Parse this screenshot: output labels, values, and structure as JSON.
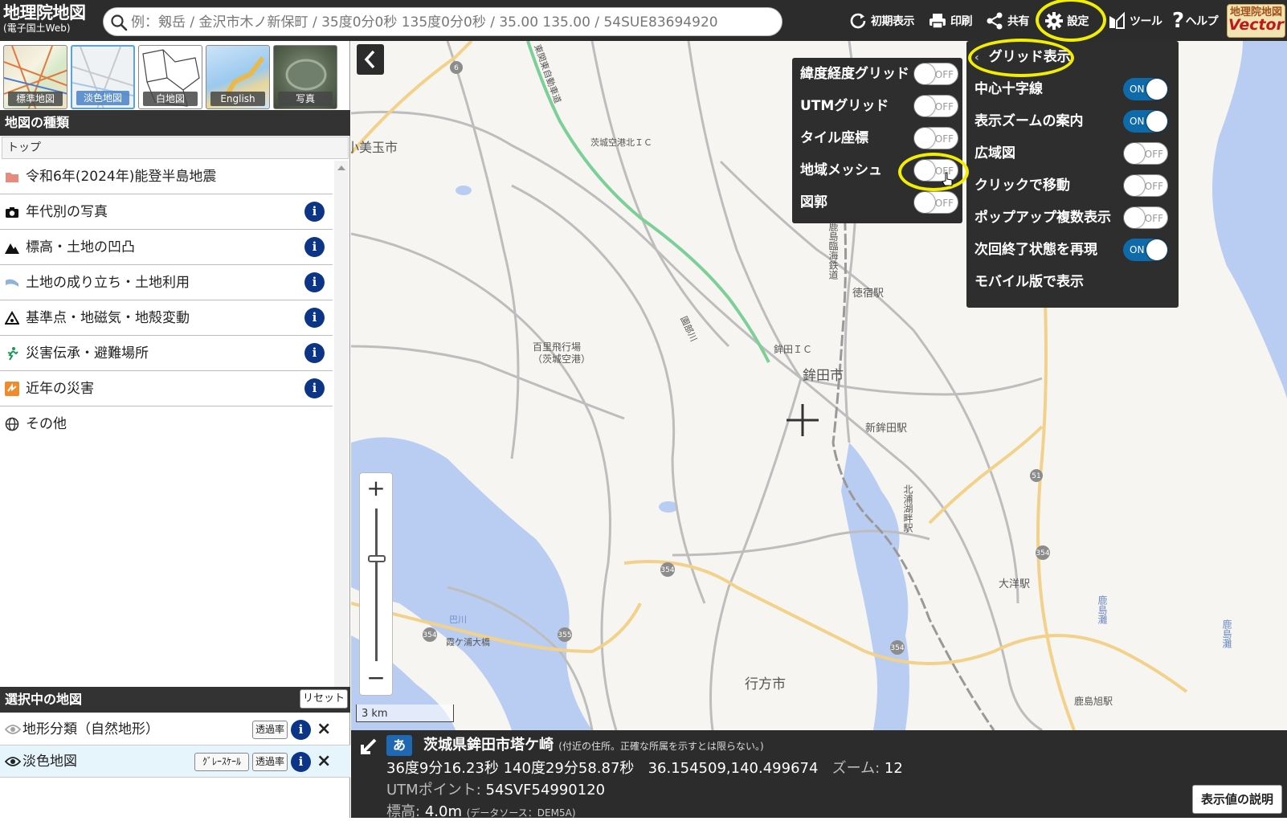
{
  "header": {
    "logo_title": "地理院地図",
    "logo_subtitle": "(電子国土Web)",
    "search_placeholder": "例：剱岳 / 金沢市木ノ新保町 / 35度0分0秒 135度0分0秒 / 35.00 135.00 / 54SUE83694920",
    "buttons": {
      "reset_view": "初期表示",
      "print": "印刷",
      "share": "共有",
      "settings": "設定",
      "tools": "ツール",
      "help": "ヘルプ"
    },
    "vector_logo_top": "地理院地図",
    "vector_logo_bottom": "Vector"
  },
  "sidebar": {
    "thumbnails": [
      {
        "label": "標準地図"
      },
      {
        "label": "淡色地図"
      },
      {
        "label": "白地図"
      },
      {
        "label": "English"
      },
      {
        "label": "写真"
      }
    ],
    "map_types_title": "地図の種類",
    "breadcrumb": "トップ",
    "items": [
      {
        "label": "令和6年(2024年)能登半島地震"
      },
      {
        "label": "年代別の写真"
      },
      {
        "label": "標高・土地の凹凸"
      },
      {
        "label": "土地の成り立ち・土地利用"
      },
      {
        "label": "基準点・地磁気・地殻変動"
      },
      {
        "label": "災害伝承・避難場所"
      },
      {
        "label": "近年の災害"
      },
      {
        "label": "その他"
      }
    ],
    "info_glyph": "i",
    "selected_title": "選択中の地図",
    "reset_label": "リセット",
    "selected_maps": [
      {
        "label": "地形分類（自然地形）",
        "opacity": "透過率"
      },
      {
        "label": "淡色地図",
        "grayscale": "ｸﾞﾚｰｽｹｰﾙ",
        "opacity": "透過率"
      }
    ],
    "close_glyph": "×"
  },
  "map": {
    "labels": {
      "omitama": "小美玉市",
      "ibaraki_airport_ic": "茨城空港北ＩＣ",
      "hyakuri": "百里飛行場",
      "hyakuri_sub": "（茨城空港）",
      "hokota_ic": "鉾田ＩＣ",
      "hokota_city": "鉾田市",
      "shin_hokota": "新鉾田駅",
      "tokushuku": "徳宿駅",
      "kashima_line": "鹿島臨海鉄道",
      "kitaura": "北浦湖畔駅",
      "oarai_station": "大洋駅",
      "namegata": "行方市",
      "kashima_nada": "鹿島灘",
      "kashimaasahi": "鹿島旭駅",
      "kasumigaura_bridge": "霞ケ浦大橋",
      "tomoe": "巴川",
      "sonobe": "園部川",
      "kashima_nada_beach": "鹿島灘",
      "expressway": "東関東自動車道"
    },
    "route_numbers": [
      "6",
      "51",
      "354",
      "354",
      "354",
      "355",
      "354",
      "51"
    ],
    "zoom_in": "+",
    "zoom_out": "−",
    "scale": "3 km",
    "center_cross": "+"
  },
  "grid_menu": {
    "rows": [
      {
        "label": "緯度経度グリッド",
        "state": "OFF"
      },
      {
        "label": "UTMグリッド",
        "state": "OFF"
      },
      {
        "label": "タイル座標",
        "state": "OFF"
      },
      {
        "label": "地域メッシュ",
        "state": "OFF"
      },
      {
        "label": "図郭",
        "state": "OFF"
      }
    ]
  },
  "settings_menu": {
    "header": "グリッド表示",
    "rows": [
      {
        "label": "中心十字線",
        "state": "ON"
      },
      {
        "label": "表示ズームの案内",
        "state": "ON"
      },
      {
        "label": "広域図",
        "state": "OFF"
      },
      {
        "label": "クリックで移動",
        "state": "OFF"
      },
      {
        "label": "ポップアップ複数表示",
        "state": "OFF"
      },
      {
        "label": "次回終了状態を再現",
        "state": "ON"
      },
      {
        "label": "モバイル版で表示",
        "state": ""
      }
    ]
  },
  "info_bar": {
    "ja_badge": "あ",
    "address": "茨城県鉾田市塔ケ崎",
    "address_note": "(付近の住所。正確な所属を示すとは限らない。)",
    "dms": "36度9分16.23秒 140度29分58.87秒",
    "decimal": "36.154509,140.499674",
    "zoom_label": "ズーム:",
    "zoom_value": "12",
    "utm_label": "UTMポイント:",
    "utm_value": "54SVF54990120",
    "elev_label": "標高:",
    "elev_value": "4.0m",
    "elev_source": "(データソース：DEM5A)",
    "explain_button": "表示値の説明"
  },
  "colors": {
    "toolbar_bg": "#2c2c2c",
    "toggle_on": "#0e6aa8",
    "highlight": "#f3ee00",
    "info_icon": "#0d3587",
    "water": "#b9cdf3",
    "expressway": "#7dcf98",
    "road": "#f2d28b"
  }
}
